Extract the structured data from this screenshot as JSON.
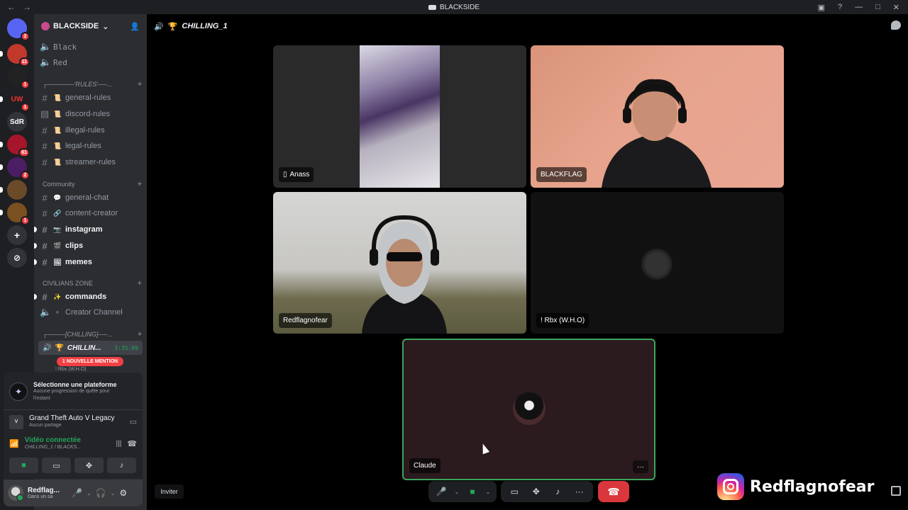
{
  "window": {
    "title": "BLACKSIDE",
    "nav_back": "←",
    "nav_forward": "→",
    "controls": [
      "▣",
      "?",
      "—",
      "□",
      "✕"
    ]
  },
  "servers": [
    {
      "label": "",
      "icon": "discord-home-icon",
      "badge": "2",
      "color": "#5865f2"
    },
    {
      "label": "",
      "icon": "server-icon",
      "badge": "11",
      "color": "#c0392b"
    },
    {
      "label": "",
      "icon": "server-icon",
      "badge": "1",
      "color": "#222"
    },
    {
      "label": "UW",
      "icon": "server-icon",
      "badge": "1",
      "color": "#1e1f22"
    },
    {
      "label": "SdR",
      "icon": "server-icon",
      "badge": "",
      "color": "#313338"
    },
    {
      "label": "",
      "icon": "server-icon",
      "badge": "61",
      "color": "#a5162a"
    },
    {
      "label": "",
      "icon": "server-icon",
      "badge": "2",
      "color": "#4b1d63"
    },
    {
      "label": "",
      "icon": "server-icon",
      "badge": "",
      "color": "#6b4a2a"
    },
    {
      "label": "",
      "icon": "server-icon",
      "badge": "1",
      "color": "#7a5020"
    },
    {
      "label": "+",
      "icon": "add-server-icon",
      "badge": "",
      "color": "#313338"
    },
    {
      "label": "⊘",
      "icon": "discover-icon",
      "badge": "",
      "color": "#313338"
    }
  ],
  "guild": {
    "name": "BLACKSIDE",
    "chevron": "⌄"
  },
  "channels": {
    "black": "Black",
    "red": "Red",
    "cat_rules": "┌──────'RULES'──...",
    "general_rules": "general-rules",
    "discord_rules": "discord-rules",
    "illegal_rules": "illegal-rules",
    "legal_rules": "legal-rules",
    "streamer_rules": "streamer-rules",
    "cat_community": "Community",
    "general_chat": "general-chat",
    "content_creator": "content-creator",
    "instagram": "instagram",
    "clips": "clips",
    "memes": "memes",
    "cat_civilians": "CIVILIANS ZONE",
    "commands": "commands",
    "creator_channel": "Creator Channel",
    "cat_chilling": "┌────[CHILLING]──...",
    "active_voice": "CHILLIN...",
    "active_timer": "3:35:09",
    "mention_pill": "1 NOUVELLE MENTION",
    "voice_member": "! Rbx (W.H.O)"
  },
  "activity": {
    "quest_title": "Sélectionne une plateforme",
    "quest_sub": "Aucune progression de quête pour l'instant",
    "game_title": "Grand Theft Auto V Legacy",
    "game_sub": "Aucun partage",
    "voice_status": "Vidéo connectée",
    "voice_location": "CHILLING_1 / BLACKS..."
  },
  "user": {
    "name": "Redflag...",
    "status": "Dans un sa"
  },
  "main": {
    "channel_title": "CHILLING_1",
    "channel_emoji": "🏆"
  },
  "tiles": {
    "anass": "Anass",
    "blackflag": "BLACKFLAG",
    "redflag": "Redflagnofear",
    "rbx": "! Rbx (W.H.O)",
    "claude": "Claude",
    "more": "···"
  },
  "controls": {
    "invite": "Inviter"
  },
  "overlay": {
    "handle": "Redflagnofear"
  }
}
